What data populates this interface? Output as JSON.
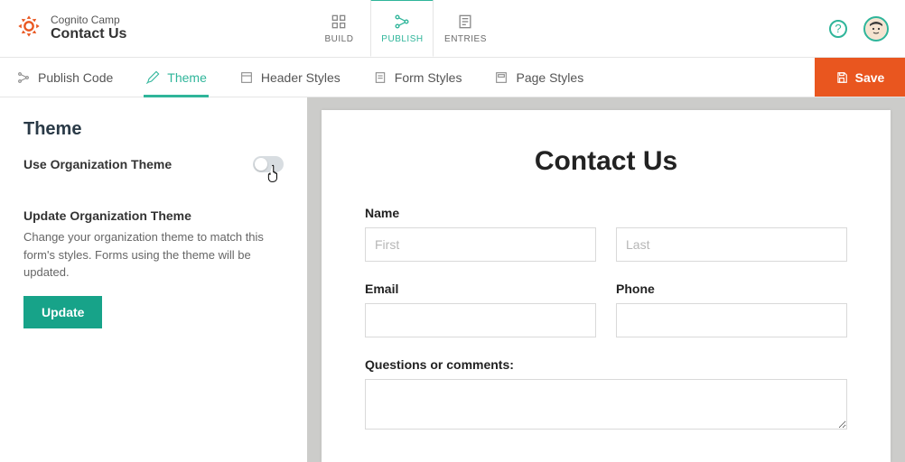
{
  "header": {
    "org": "Cognito Camp",
    "form_name": "Contact Us",
    "tabs": {
      "build": "BUILD",
      "publish": "PUBLISH",
      "entries": "ENTRIES"
    }
  },
  "secbar": {
    "publish_code": "Publish Code",
    "theme": "Theme",
    "header_styles": "Header Styles",
    "form_styles": "Form Styles",
    "page_styles": "Page Styles",
    "save": "Save"
  },
  "sidebar": {
    "title": "Theme",
    "use_org_theme_label": "Use Organization Theme",
    "update_title": "Update Organization Theme",
    "update_desc": "Change your organization theme to match this form's styles. Forms using the theme will be updated.",
    "update_btn": "Update"
  },
  "preview": {
    "title": "Contact Us",
    "name_label": "Name",
    "first_placeholder": "First",
    "last_placeholder": "Last",
    "email_label": "Email",
    "phone_label": "Phone",
    "comments_label": "Questions or comments:"
  }
}
